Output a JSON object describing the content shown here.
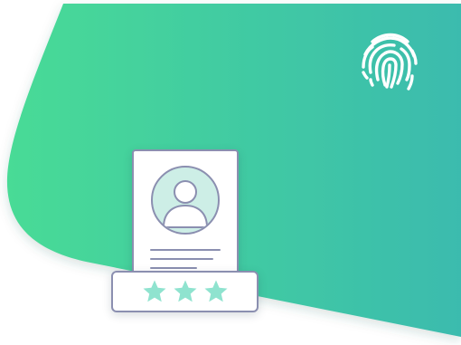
{
  "colors": {
    "gradient_start": "#48db96",
    "gradient_end": "#3bbbae",
    "card_border": "#8b8fb0",
    "avatar_fill": "#cdeee6",
    "star_fill": "#8fe3cf",
    "fingerprint": "#ffffff"
  },
  "icons": {
    "fingerprint": "fingerprint-icon",
    "avatar": "user-avatar-icon",
    "star": "star-icon"
  },
  "rating": {
    "stars_filled": 3,
    "stars_total": 3
  }
}
